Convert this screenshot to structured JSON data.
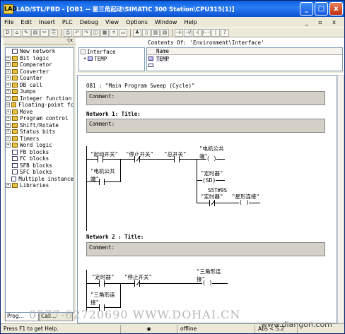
{
  "window": {
    "title": "LAD/STL/FBD  - [OB1 -- 星三角起动\\SIMATIC 300 Station\\CPU315(1)]",
    "app_icon": "LAD",
    "controls": [
      "_",
      "□",
      "x"
    ]
  },
  "menu": [
    "File",
    "Edit",
    "Insert",
    "PLC",
    "Debug",
    "View",
    "Options",
    "Window",
    "Help"
  ],
  "menu_mdi": "_ ▫ x",
  "toolbar": [
    "D",
    "⌂",
    "✎",
    "▤",
    "✂",
    "⎘",
    "⎙",
    "↶",
    "↷",
    "◫",
    "▦",
    "⌾",
    "▭",
    "♣",
    "▯",
    "▥",
    "▤",
    "⊣⊢",
    "⊣/⊢",
    "-( )",
    "⊢⊣",
    "|",
    "?"
  ],
  "catalog": {
    "header": "-|x",
    "items": [
      {
        "label": "New network",
        "expand": "",
        "icon": "blk"
      },
      {
        "label": "Bit logic",
        "expand": "+",
        "icon": "fld"
      },
      {
        "label": "Comparator",
        "expand": "+",
        "icon": "fld"
      },
      {
        "label": "Converter",
        "expand": "+",
        "icon": "fld"
      },
      {
        "label": "Counter",
        "expand": "+",
        "icon": "fld"
      },
      {
        "label": "DB call",
        "expand": "+",
        "icon": "fld"
      },
      {
        "label": "Jumps",
        "expand": "+",
        "icon": "fld"
      },
      {
        "label": "Integer function",
        "expand": "+",
        "icon": "fld"
      },
      {
        "label": "Floating-point fc",
        "expand": "+",
        "icon": "fld"
      },
      {
        "label": "Move",
        "expand": "+",
        "icon": "fld"
      },
      {
        "label": "Program control",
        "expand": "+",
        "icon": "fld"
      },
      {
        "label": "Shift/Rotate",
        "expand": "+",
        "icon": "fld"
      },
      {
        "label": "Status bits",
        "expand": "+",
        "icon": "fld"
      },
      {
        "label": "Timers",
        "expand": "+",
        "icon": "fld"
      },
      {
        "label": "Word logic",
        "expand": "+",
        "icon": "fld"
      },
      {
        "label": "FB blocks",
        "expand": "",
        "icon": "blk"
      },
      {
        "label": "FC blocks",
        "expand": "",
        "icon": "blk"
      },
      {
        "label": "SFB blocks",
        "expand": "",
        "icon": "blk"
      },
      {
        "label": "SFC blocks",
        "expand": "",
        "icon": "blk"
      },
      {
        "label": "Multiple instance",
        "expand": "",
        "icon": "blk"
      },
      {
        "label": "Libraries",
        "expand": "+",
        "icon": "fld"
      }
    ],
    "tabs": [
      "Prog...",
      "Call..."
    ]
  },
  "interface": {
    "contents_title": "Contents Of: 'Environment\\Interface'",
    "tree_root": "Interface",
    "tree_child": "TEMP",
    "col_name": "Name",
    "row1": "TEMP"
  },
  "editor": {
    "block_header": "OB1 :  \"Main Program Sweep (Cycle)\"",
    "comment_label": "Comment:",
    "network1": {
      "title": "Network 1: Title:",
      "comment": "Comment:"
    },
    "network2": {
      "title": "Network 2 : Title:",
      "comment": "Comment:"
    },
    "n1_contacts": [
      "\"起动开关\"",
      "\"停止开关\"",
      "\"总开关\"",
      "\"电机公共\n端\""
    ],
    "n1_coil_motor": "\"电机公共\n端\"",
    "n1_coil_motor_sym": "( )",
    "n1_timer": "\"定时器\"",
    "n1_timer_sym": "(SD)",
    "n1_timer_value": "S5T#9S",
    "n1_star_contact": "\"定时器\"",
    "n1_star_coil": "\"星形连接\"",
    "n2_contacts": [
      "\"定时器\"",
      "\"停止开关\""
    ],
    "n2_coil": "\"三角形连\n接\"",
    "n2_seal": "\"三角形连\n接\""
  },
  "statusbar": {
    "help": "Press F1 to get Help.",
    "mode": "offline",
    "abs": "Abs < 5.2"
  },
  "watermark": "0577-62720690   WWW.DOHAI.CN",
  "watermark2": "www.diangon.com"
}
